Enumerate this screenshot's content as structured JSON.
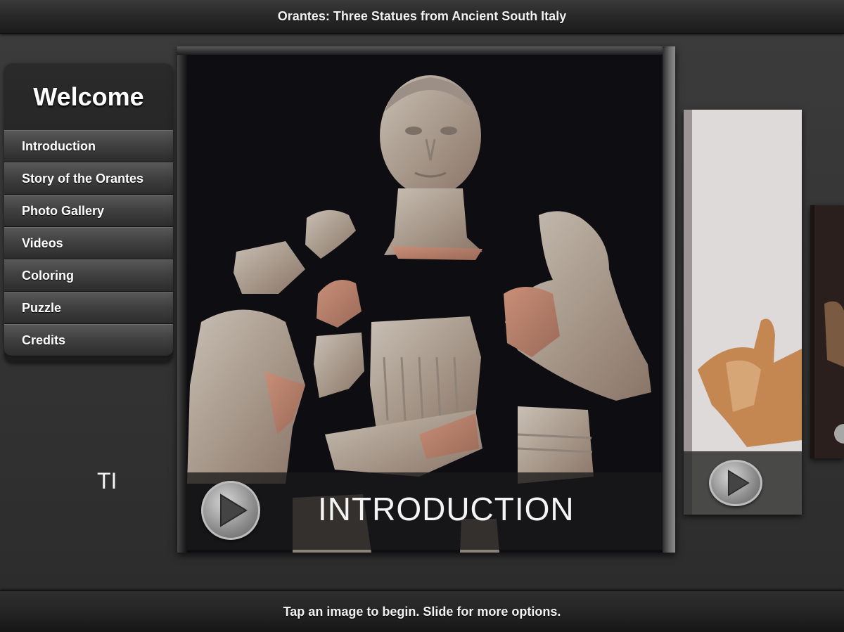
{
  "header": {
    "title": "Orantes: Three Statues from Ancient South Italy"
  },
  "sidebar": {
    "title": "Welcome",
    "items": [
      {
        "label": "Introduction"
      },
      {
        "label": "Story of the Orantes"
      },
      {
        "label": "Photo Gallery"
      },
      {
        "label": "Videos"
      },
      {
        "label": "Coloring"
      },
      {
        "label": "Puzzle"
      },
      {
        "label": "Credits"
      }
    ]
  },
  "carousel": {
    "cards": [
      {
        "caption": "INTRODUCTION",
        "icon": "play-icon"
      },
      {
        "caption": "TI",
        "icon": "play-icon"
      },
      {
        "caption": "",
        "icon": ""
      }
    ]
  },
  "footer": {
    "hint": "Tap an image to begin. Slide for more options."
  },
  "colors": {
    "bar_dark": "#1b1b1b",
    "background": "#333333",
    "caption_text": "#f4f4f4"
  }
}
